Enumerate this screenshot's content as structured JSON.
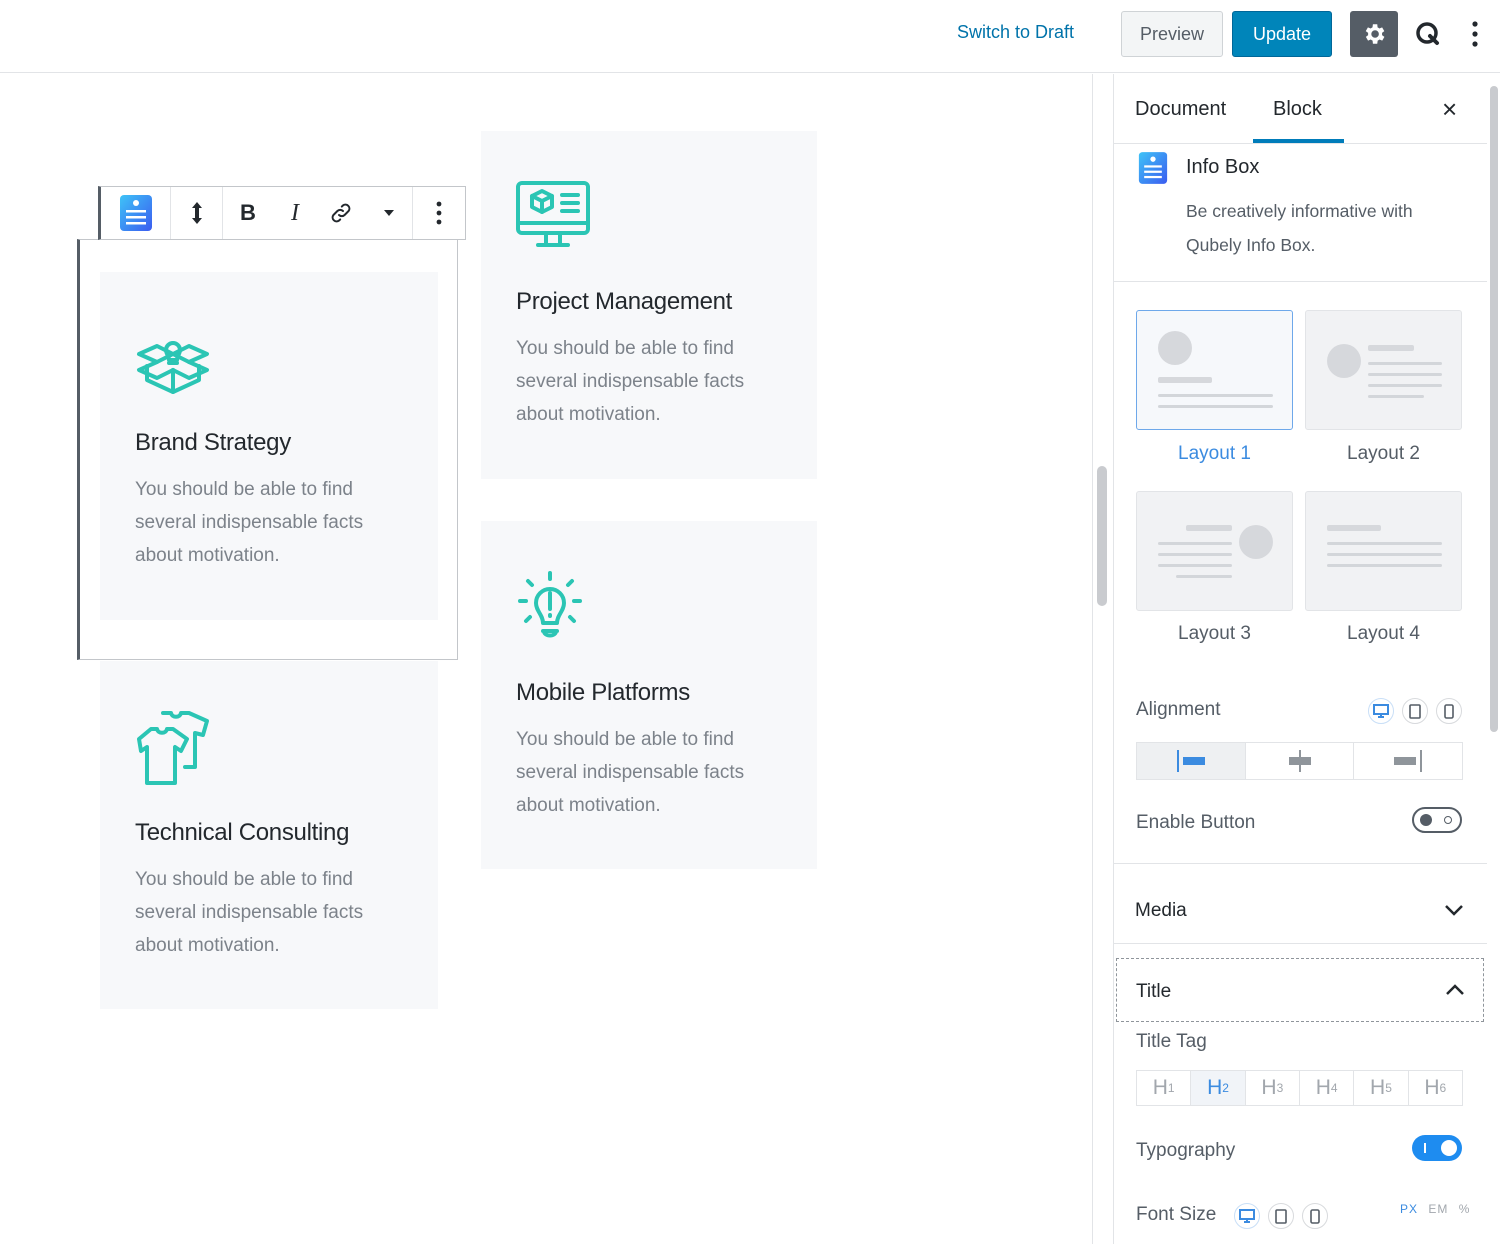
{
  "topbar": {
    "switch_draft": "Switch to Draft",
    "preview": "Preview",
    "update": "Update",
    "settings_icon": "gear-icon",
    "plugin_icon": "qubely-q-icon",
    "more_icon": "more-vertical-icon"
  },
  "toolbar": {
    "block_icon": "info-box-icon",
    "move_icon": "move-vertical-icon",
    "bold": "B",
    "italic": "I",
    "link_icon": "link-icon",
    "dropdown_icon": "caret-down-icon",
    "more_icon": "more-vertical-icon"
  },
  "cards": [
    {
      "title": "Brand Strategy",
      "desc": "You should be able to find several indispensable facts about motivation.",
      "icon": "box-idea-icon"
    },
    {
      "title": "Project Management",
      "desc": "You should be able to find several indispensable facts about motivation.",
      "icon": "monitor-cube-icon"
    },
    {
      "title": "Technical Consulting",
      "desc": "You should be able to find several indispensable facts about motivation.",
      "icon": "shirts-icon"
    },
    {
      "title": "Mobile Platforms",
      "desc": "You should be able to find several indispensable facts about motivation.",
      "icon": "lightbulb-icon"
    }
  ],
  "sidebar": {
    "tabs": [
      {
        "label": "Document",
        "active": false
      },
      {
        "label": "Block",
        "active": true
      }
    ],
    "close": "×",
    "block": {
      "name": "Info Box",
      "description": "Be creatively informative with Qubely Info Box."
    },
    "layouts": [
      {
        "label": "Layout 1",
        "active": true
      },
      {
        "label": "Layout 2",
        "active": false
      },
      {
        "label": "Layout 3",
        "active": false
      },
      {
        "label": "Layout 4",
        "active": false
      }
    ],
    "alignment": {
      "label": "Alignment",
      "devices": [
        "desktop-icon",
        "tablet-icon",
        "mobile-icon"
      ],
      "options": [
        "align-left-icon",
        "align-center-icon",
        "align-right-icon"
      ],
      "selected": "left"
    },
    "enable_button": {
      "label": "Enable Button",
      "on": false
    },
    "sections": [
      {
        "label": "Media",
        "expanded": false
      },
      {
        "label": "Title",
        "expanded": true
      }
    ],
    "title_tag": {
      "label": "Title Tag",
      "options": [
        {
          "h": "H",
          "n": "1"
        },
        {
          "h": "H",
          "n": "2"
        },
        {
          "h": "H",
          "n": "3"
        },
        {
          "h": "H",
          "n": "4"
        },
        {
          "h": "H",
          "n": "5"
        },
        {
          "h": "H",
          "n": "6"
        }
      ],
      "selected": "H2"
    },
    "typography": {
      "label": "Typography",
      "on": true
    },
    "font_size": {
      "label": "Font Size",
      "units": [
        "PX",
        "EM",
        "%"
      ],
      "selected_unit": "PX"
    }
  },
  "colors": {
    "accent": "#0085ba",
    "icon_teal": "#2bc5b4",
    "active_blue": "#3b8be0"
  }
}
